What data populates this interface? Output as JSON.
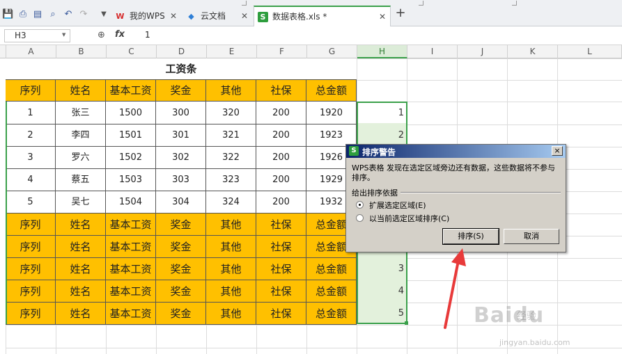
{
  "tabs": [
    {
      "label": "我的WPS",
      "icon": "W"
    },
    {
      "label": "云文档",
      "icon": "◆"
    },
    {
      "label": "数据表格.xls *",
      "icon": "S"
    }
  ],
  "formula": {
    "cell_ref": "H3",
    "fx": "fx",
    "value": "1"
  },
  "columns": [
    "A",
    "B",
    "C",
    "D",
    "E",
    "F",
    "G",
    "H",
    "I",
    "J",
    "K",
    "L"
  ],
  "sheet": {
    "title": "工资条",
    "headers": [
      "序列",
      "姓名",
      "基本工资",
      "奖金",
      "其他",
      "社保",
      "总金额"
    ],
    "rows": [
      [
        "1",
        "张三",
        "1500",
        "300",
        "320",
        "200",
        "1920"
      ],
      [
        "2",
        "李四",
        "1501",
        "301",
        "321",
        "200",
        "1923"
      ],
      [
        "3",
        "罗六",
        "1502",
        "302",
        "322",
        "200",
        "1926"
      ],
      [
        "4",
        "蔡五",
        "1503",
        "303",
        "323",
        "200",
        "1929"
      ],
      [
        "5",
        "吴七",
        "1504",
        "304",
        "324",
        "200",
        "1932"
      ]
    ],
    "h_values": [
      "1",
      "2",
      "",
      "",
      "",
      "",
      "",
      "3",
      "4",
      "5"
    ]
  },
  "dialog": {
    "title": "排序警告",
    "icon": "S",
    "close": "×",
    "message": "WPS表格 发现在选定区域旁边还有数据，这些数据将不参与排序。",
    "group_label": "给出排序依据",
    "option_expand": "扩展选定区域(E)",
    "option_current": "以当前选定区域排序(C)",
    "sort_button": "排序(S)",
    "cancel_button": "取消"
  },
  "colors": {
    "header_fill": "#ffc000",
    "accent_green": "#3aa04a",
    "arrow_red": "#e83a3a"
  },
  "watermark": {
    "brand": "Baidu",
    "suffix": "经验",
    "url": "jingyan.baidu.com"
  }
}
